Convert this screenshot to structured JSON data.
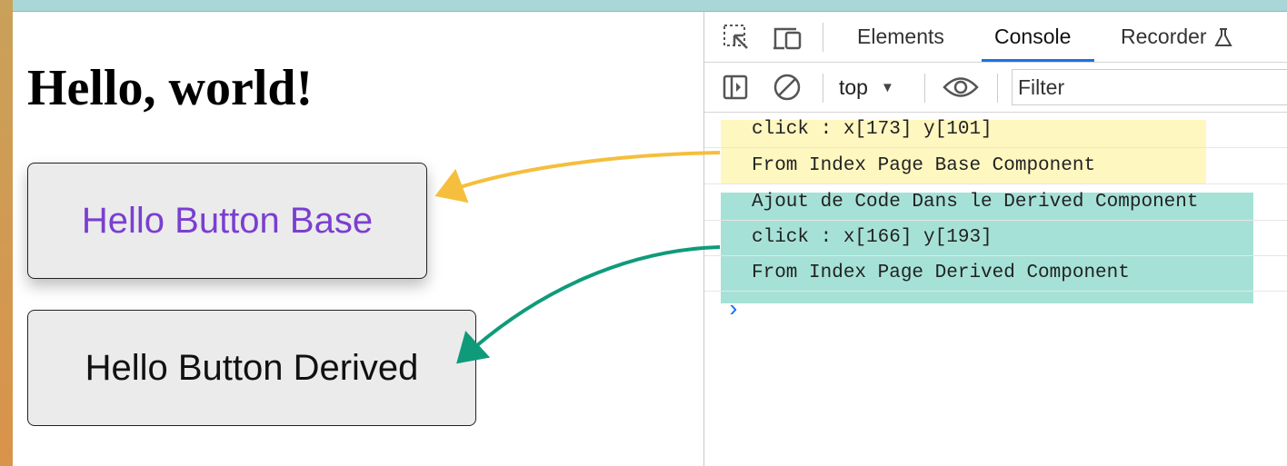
{
  "page": {
    "heading": "Hello, world!",
    "button_base": "Hello Button Base",
    "button_derived": "Hello Button Derived"
  },
  "devtools": {
    "tabs": [
      {
        "label": "Elements",
        "active": false
      },
      {
        "label": "Console",
        "active": true
      },
      {
        "label": "Recorder",
        "active": false
      }
    ],
    "recorder_icon": "flask-icon",
    "context": "top",
    "filter_placeholder": "Filter",
    "logs": [
      "click : x[173] y[101]",
      "From Index Page Base Component",
      "Ajout de Code Dans le Derived Component",
      "click : x[166] y[193]",
      "From Index Page Derived Component"
    ],
    "prompt": "›"
  },
  "colors": {
    "base_button_text": "#7a3fd1",
    "yellow_highlight": "#fff7c0",
    "teal_highlight": "#a6e1d7",
    "arrow_yellow": "#f5be3c",
    "arrow_teal": "#0f9b7a",
    "active_tab_underline": "#1a73e8"
  }
}
